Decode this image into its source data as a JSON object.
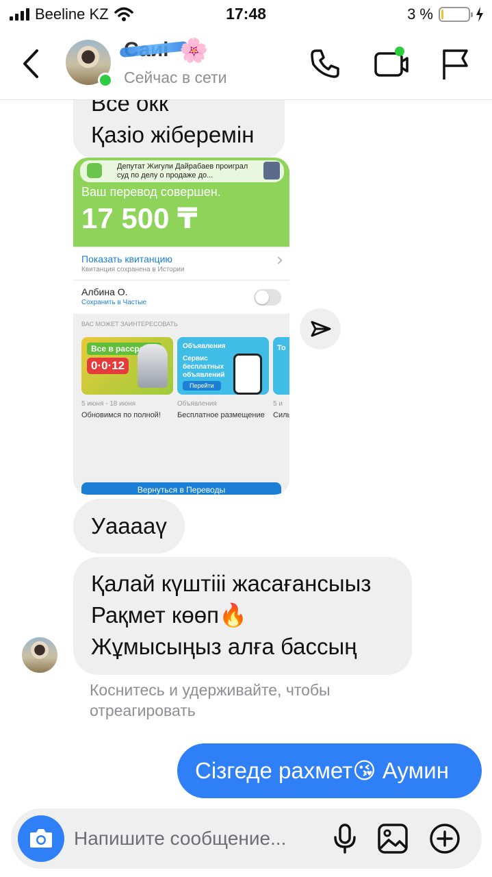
{
  "status_bar": {
    "carrier": "Beeline KZ",
    "time": "17:48",
    "battery": "3 %"
  },
  "header": {
    "contact_name": "Саиі",
    "contact_emoji": "🌸",
    "presence": "Сейчас в сети"
  },
  "messages": [
    {
      "direction": "incoming",
      "lines": [
        "Все окк",
        "Қазіо жіберемін"
      ]
    },
    {
      "direction": "incoming",
      "type": "image",
      "screenshot": {
        "notification_text": "Депутат Жигули Дайрабаев проиграл суд по делу о продаже до...",
        "transfer_title": "Ваш перевод совершен.",
        "amount": "17 500 ₸",
        "receipt_link": "Показать квитанцию",
        "receipt_sub": "Квитанция сохранена в Истории",
        "recipient": "Албина О.",
        "save_to_frequent": "Сохранить в Частые",
        "interest_heading": "ВАС МОЖЕТ ЗАИНТЕРЕСОВАТЬ",
        "cards": [
          {
            "badge": "Все в рассрочку",
            "number": "0·0·12",
            "date": "5 июня - 18 июня",
            "caption": "Обновимся по полной!"
          },
          {
            "title": "Объявления",
            "body": "Сервис бесплатных объявлений",
            "button": "Перейти",
            "date": "Объявления",
            "caption": "Бесплатное размещение"
          },
          {
            "title": "То",
            "date": "5 и",
            "caption": "Силь"
          }
        ],
        "bottom_button": "Вернуться в Переводы"
      }
    },
    {
      "direction": "incoming",
      "lines": [
        "Уааааү"
      ]
    },
    {
      "direction": "incoming",
      "lines": [
        "Қалай күштііі жасағансыыз",
        "Рақмет көөп🔥",
        "Жұмысыңыз алға бассың"
      ]
    },
    {
      "direction": "outgoing",
      "lines": [
        "Сізгеде рахмет😘 Аумин"
      ]
    }
  ],
  "reaction_hint": "Коснитесь и удерживайте, чтобы отреагировать",
  "composer": {
    "placeholder": "Напишите сообщение..."
  },
  "colors": {
    "outgoing_bubble": "#2f7ff6",
    "incoming_bubble": "#efefef",
    "online": "#2ecc40",
    "transfer_green": "#8fd45a"
  },
  "icons": {
    "back": "chevron-left-icon",
    "call": "phone-icon",
    "video": "video-camera-icon",
    "report": "flag-icon",
    "share": "send-icon",
    "camera": "camera-icon",
    "mic": "microphone-icon",
    "gallery": "image-icon",
    "more": "plus-circle-icon"
  }
}
